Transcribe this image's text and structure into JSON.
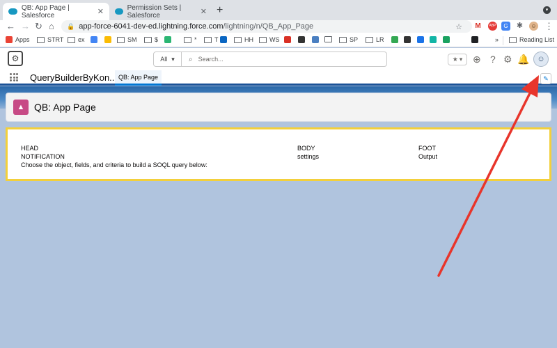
{
  "browser": {
    "tabs": [
      {
        "title": "QB: App Page | Salesforce",
        "active": true
      },
      {
        "title": "Permission Sets | Salesforce",
        "active": false
      }
    ],
    "new_tab_symbol": "+",
    "url_host": "app-force-6041-dev-ed.lightning.force.com",
    "url_path": "/lightning/n/QB_App_Page",
    "extensions": [
      {
        "name": "gmail-icon",
        "label": "M",
        "badge": "2",
        "color": "#d93025"
      },
      {
        "name": "abp-icon",
        "label": "ABP",
        "color": "#e53935"
      },
      {
        "name": "translate-icon",
        "label": "G",
        "color": "#4285f4"
      },
      {
        "name": "puzzle-icon",
        "label": "✱",
        "color": "#5f6368"
      },
      {
        "name": "profile-icon",
        "label": "☺",
        "color": "#c68642"
      }
    ],
    "bookmarks": [
      {
        "label": "Apps",
        "icon": "apps-grid-icon",
        "color": "#ea4335"
      },
      {
        "label": "STRT",
        "icon": "folder-icon",
        "color": "#5f6368"
      },
      {
        "label": "ex",
        "icon": "folder-icon",
        "color": "#5f6368"
      },
      {
        "label": "",
        "icon": "translate-icon",
        "color": "#4285f4"
      },
      {
        "label": "",
        "icon": "keep-icon",
        "color": "#fbbc04"
      },
      {
        "label": "SM",
        "icon": "folder-icon",
        "color": "#5f6368"
      },
      {
        "label": "$",
        "icon": "folder-icon",
        "color": "#5f6368"
      },
      {
        "label": "",
        "icon": "m-icon",
        "color": "#2bb673"
      },
      {
        "label": "*",
        "icon": "folder-icon",
        "color": "#5f6368"
      },
      {
        "label": "T",
        "icon": "folder-icon",
        "color": "#5f6368"
      },
      {
        "label": "",
        "icon": "linkedin-icon",
        "color": "#0a66c2"
      },
      {
        "label": "HH",
        "icon": "folder-icon",
        "color": "#5f6368"
      },
      {
        "label": "WS",
        "icon": "folder-icon",
        "color": "#5f6368"
      },
      {
        "label": "",
        "icon": "bookmark-red-icon",
        "color": "#d93025"
      },
      {
        "label": "",
        "icon": "circle-icon",
        "color": "#333333"
      },
      {
        "label": "",
        "icon": "r-icon",
        "color": "#4a7fc1"
      },
      {
        "label": "",
        "icon": "folder-icon",
        "color": "#5f6368"
      },
      {
        "label": "SP",
        "icon": "folder-icon",
        "color": "#5f6368"
      },
      {
        "label": "LR",
        "icon": "folder-icon",
        "color": "#5f6368"
      },
      {
        "label": "",
        "icon": "green-circle-icon",
        "color": "#34a853"
      },
      {
        "label": "",
        "icon": "sigma-icon",
        "color": "#333333"
      },
      {
        "label": "",
        "icon": "k-icon",
        "color": "#1a73e8"
      },
      {
        "label": "",
        "icon": "teal-icon",
        "color": "#12b5a6"
      },
      {
        "label": "",
        "icon": "hex-icon",
        "color": "#1aa260"
      },
      {
        "label": "",
        "icon": "black-sq-icon",
        "color": "#202124"
      }
    ],
    "overflow": "»",
    "reading_list": "Reading List"
  },
  "salesforce": {
    "search_scope": "All",
    "search_placeholder": "Search...",
    "app_name": "QueryBuilderByKon...",
    "nav_tab": "QB: App Page",
    "page_title": "QB: App Page"
  },
  "card": {
    "columns": [
      {
        "lines": [
          "HEAD",
          "NOTIFICATION",
          "Choose the object, fields, and criteria to build a SOQL query below:"
        ]
      },
      {
        "lines": [
          "BODY",
          "settings"
        ]
      },
      {
        "lines": [
          "FOOT",
          "Output"
        ]
      }
    ]
  },
  "annotation": {
    "color": "#e8352b"
  }
}
